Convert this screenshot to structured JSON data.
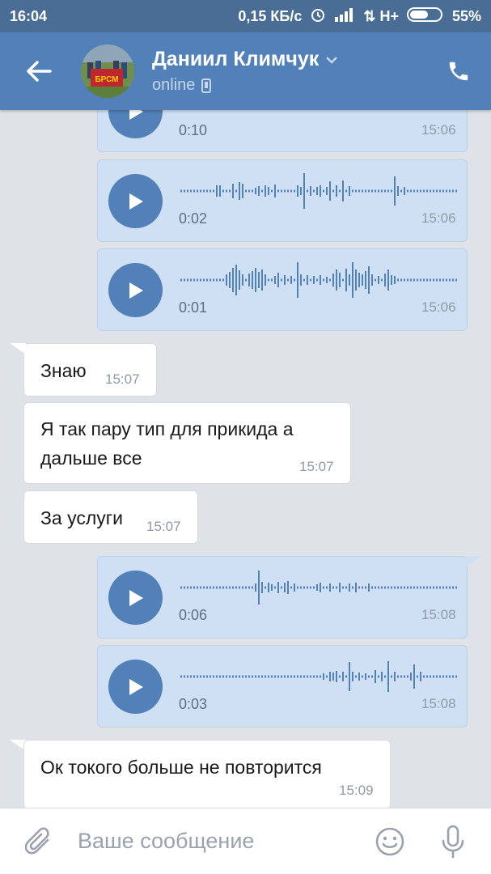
{
  "status_bar": {
    "time": "16:04",
    "speed": "0,15 КБ/с",
    "network": "H+",
    "battery": "55%"
  },
  "header": {
    "contact_name": "Даниил Климчук",
    "status": "online",
    "avatar_flag_text": "БРСМ"
  },
  "messages": [
    {
      "type": "voice",
      "direction": "out",
      "duration": "0:10",
      "time": "15:06"
    },
    {
      "type": "voice",
      "direction": "out",
      "duration": "0:02",
      "time": "15:06"
    },
    {
      "type": "voice",
      "direction": "out",
      "duration": "0:01",
      "time": "15:06"
    },
    {
      "type": "text",
      "direction": "in",
      "text": "Знаю",
      "time": "15:07"
    },
    {
      "type": "text",
      "direction": "in",
      "lines": [
        "Я так пару тип для прикида а",
        "дальше все"
      ],
      "time": "15:07"
    },
    {
      "type": "text",
      "direction": "in",
      "text": "За услуги",
      "time": "15:07"
    },
    {
      "type": "voice",
      "direction": "out",
      "duration": "0:06",
      "time": "15:08"
    },
    {
      "type": "voice",
      "direction": "out",
      "duration": "0:03",
      "time": "15:08"
    },
    {
      "type": "text",
      "direction": "in",
      "text": "Ок токого больше не повторится",
      "time": "15:09"
    }
  ],
  "composer": {
    "placeholder": "Ваше сообщение"
  },
  "colors": {
    "header": "#5181b8",
    "status_bar": "#4a6d96",
    "outgoing_bubble": "#cfe0f5",
    "incoming_bubble": "#ffffff",
    "background": "#dfe3e8"
  },
  "icons": [
    "back-arrow-icon",
    "chevron-down-icon",
    "phone-icon",
    "mobile-icon",
    "play-icon",
    "paperclip-icon",
    "smile-icon",
    "microphone-icon"
  ]
}
